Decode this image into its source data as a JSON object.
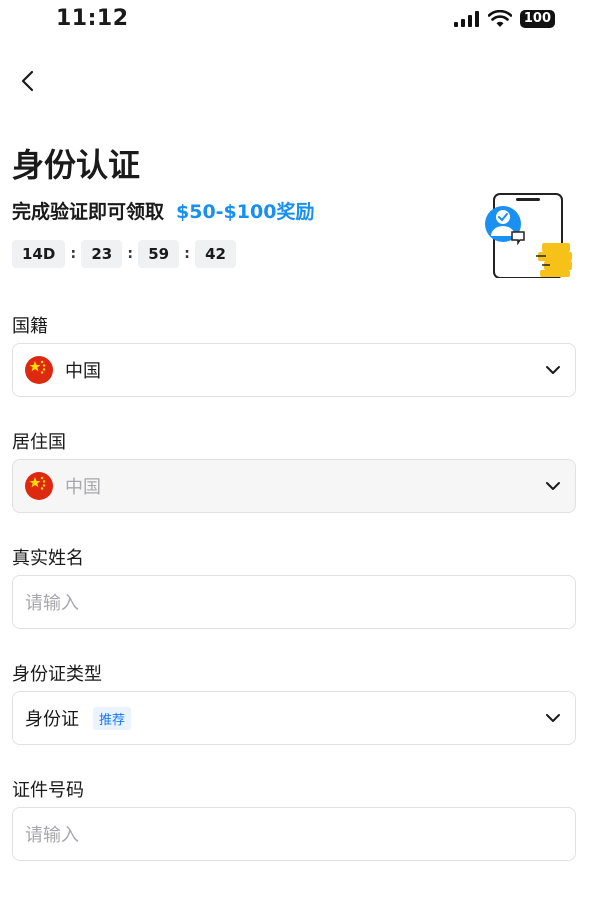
{
  "status_bar": {
    "time": "11:12",
    "battery": "100"
  },
  "header": {
    "title": "身份认证",
    "subtitle": "完成验证即可领取",
    "reward": "$50-$100奖励"
  },
  "countdown": {
    "days": "14D",
    "hours": "23",
    "minutes": "59",
    "seconds": "42",
    "separator": ":"
  },
  "form": {
    "nationality": {
      "label": "国籍",
      "value": "中国"
    },
    "residence": {
      "label": "居住国",
      "value": "中国"
    },
    "real_name": {
      "label": "真实姓名",
      "placeholder": "请输入"
    },
    "id_type": {
      "label": "身份证类型",
      "value": "身份证",
      "tag": "推荐"
    },
    "id_number": {
      "label": "证件号码",
      "placeholder": "请输入"
    }
  },
  "colors": {
    "accent": "#1890f0",
    "flag_red": "#de2910",
    "flag_star": "#ffde00"
  },
  "icons": [
    "back-arrow-icon",
    "cellular-signal-icon",
    "wifi-icon",
    "battery-icon",
    "chevron-down-icon",
    "china-flag-icon",
    "verified-user-illustration"
  ]
}
